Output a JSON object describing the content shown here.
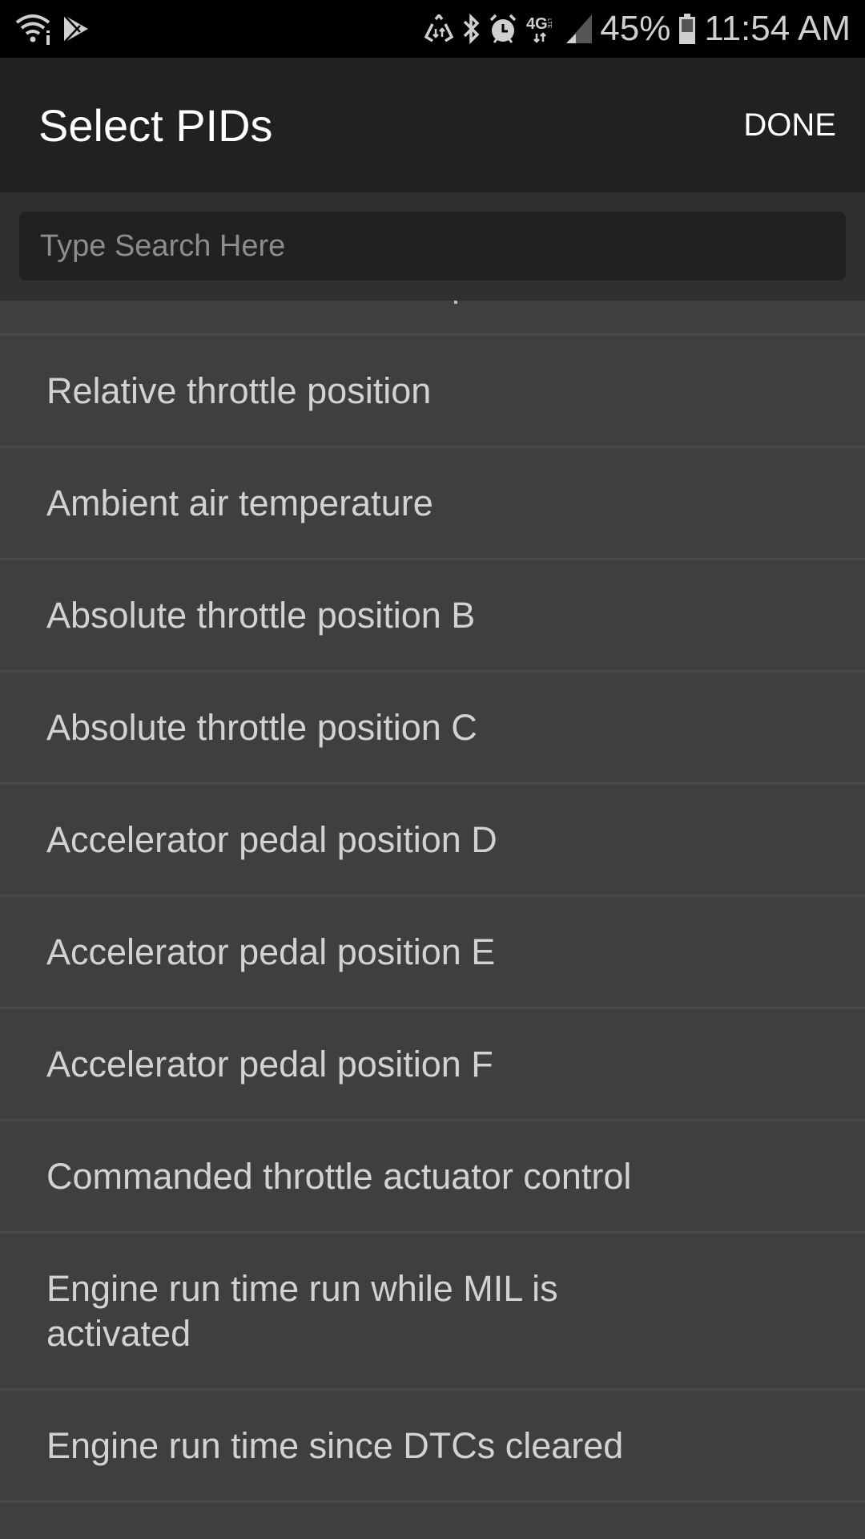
{
  "status_bar": {
    "left_icons": [
      "wifi-icon",
      "play-store-icon"
    ],
    "right_icons": [
      "data-saver-icon",
      "bluetooth-icon",
      "alarm-icon",
      "4g-lte-icon",
      "signal-icon"
    ],
    "battery_percent": "45%",
    "time": "11:54 AM"
  },
  "toolbar": {
    "title": "Select PIDs",
    "done_label": "DONE"
  },
  "search": {
    "value": "",
    "placeholder": "Type Search Here"
  },
  "pid_list": {
    "items": [
      {
        "label": "Relative throttle position"
      },
      {
        "label": "Ambient air temperature"
      },
      {
        "label": "Absolute throttle position B"
      },
      {
        "label": "Absolute throttle position C"
      },
      {
        "label": "Accelerator pedal position D"
      },
      {
        "label": "Accelerator pedal position E"
      },
      {
        "label": "Accelerator pedal position F"
      },
      {
        "label": "Commanded throttle actuator control"
      },
      {
        "label": "Engine run time run while MIL is activated"
      },
      {
        "label": "Engine run time since DTCs cleared"
      }
    ]
  }
}
